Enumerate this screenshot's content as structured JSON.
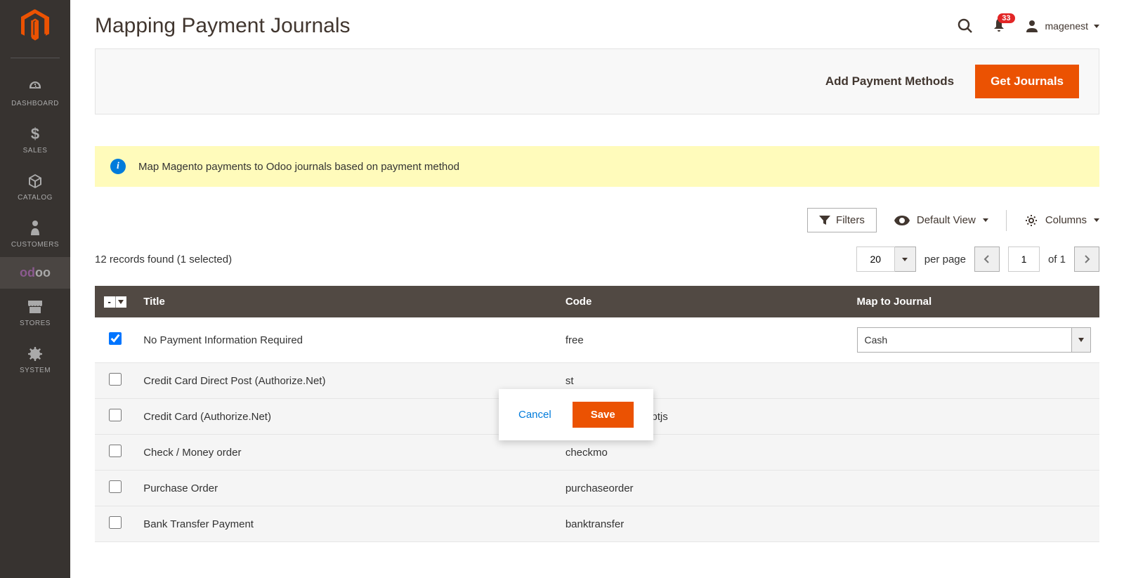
{
  "sidebar": {
    "items": [
      {
        "label": "DASHBOARD",
        "icon": "dashboard"
      },
      {
        "label": "SALES",
        "icon": "dollar"
      },
      {
        "label": "CATALOG",
        "icon": "box"
      },
      {
        "label": "CUSTOMERS",
        "icon": "person"
      },
      {
        "label": "odoo",
        "icon": "odoo"
      },
      {
        "label": "STORES",
        "icon": "store"
      },
      {
        "label": "SYSTEM",
        "icon": "gear"
      }
    ]
  },
  "header": {
    "title": "Mapping Payment Journals",
    "notification_count": "33",
    "user_name": "magenest"
  },
  "actions": {
    "add_payment": "Add Payment Methods",
    "get_journals": "Get Journals"
  },
  "banner": {
    "text": "Map Magento payments to Odoo journals based on payment method"
  },
  "controls": {
    "filters": "Filters",
    "default_view": "Default View",
    "columns": "Columns"
  },
  "toolbar": {
    "records_text": "12 records found (1 selected)",
    "page_size": "20",
    "per_page": "per page",
    "current_page": "1",
    "of_text": "of 1"
  },
  "columns": {
    "title": "Title",
    "code": "Code",
    "map_to_journal": "Map to Journal"
  },
  "rows": [
    {
      "selected": true,
      "title": "No Payment Information Required",
      "code": "free",
      "journal": "Cash"
    },
    {
      "selected": false,
      "title": "Credit Card Direct Post (Authorize.Net)",
      "code": "st",
      "journal": ""
    },
    {
      "selected": false,
      "title": "Credit Card (Authorize.Net)",
      "code": "authorizenet_acceptjs",
      "journal": ""
    },
    {
      "selected": false,
      "title": "Check / Money order",
      "code": "checkmo",
      "journal": ""
    },
    {
      "selected": false,
      "title": "Purchase Order",
      "code": "purchaseorder",
      "journal": ""
    },
    {
      "selected": false,
      "title": "Bank Transfer Payment",
      "code": "banktransfer",
      "journal": ""
    }
  ],
  "modal": {
    "cancel": "Cancel",
    "save": "Save"
  }
}
